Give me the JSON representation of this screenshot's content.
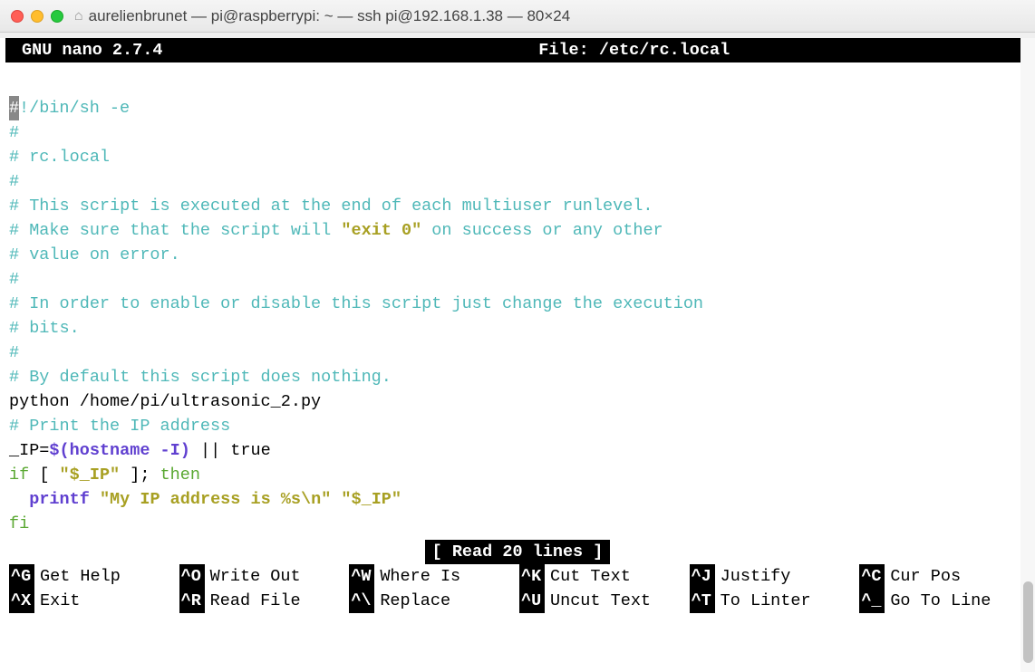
{
  "window": {
    "title": "aurelienbrunet — pi@raspberrypi: ~ — ssh pi@192.168.1.38 — 80×24"
  },
  "nano": {
    "app_name": "GNU nano 2.7.4",
    "file_label": "File: /etc/rc.local",
    "status": "[ Read 20 lines ]"
  },
  "content": {
    "l1_a": "#",
    "l1_b": "!/bin/sh -e",
    "l2": "#",
    "l3": "# rc.local",
    "l4": "#",
    "l5": "# This script is executed at the end of each multiuser runlevel.",
    "l6a": "# Make sure that the script will ",
    "l6b": "\"exit 0\"",
    "l6c": " on success or any other",
    "l7": "# value on error.",
    "l8": "#",
    "l9": "# In order to enable or disable this script just change the execution",
    "l10": "# bits.",
    "l11": "#",
    "l12": "# By default this script does nothing.",
    "l13": "python /home/pi/ultrasonic_2.py",
    "l14": "# Print the IP address",
    "l15a": "_IP=",
    "l15b": "$(hostname -I)",
    "l15c": " || true",
    "l16a": "if",
    "l16b": " [ ",
    "l16c": "\"$_IP\"",
    "l16d": " ]; ",
    "l16e": "then",
    "l17a": "  ",
    "l17b": "printf",
    "l17c": " ",
    "l17d": "\"My IP address is %s\\n\" \"$_IP\"",
    "l18": "fi"
  },
  "shortcuts": [
    {
      "key": "^G",
      "label": "Get Help"
    },
    {
      "key": "^O",
      "label": "Write Out"
    },
    {
      "key": "^W",
      "label": "Where Is"
    },
    {
      "key": "^K",
      "label": "Cut Text"
    },
    {
      "key": "^J",
      "label": "Justify"
    },
    {
      "key": "^C",
      "label": "Cur Pos"
    },
    {
      "key": "^X",
      "label": "Exit"
    },
    {
      "key": "^R",
      "label": "Read File"
    },
    {
      "key": "^\\",
      "label": "Replace"
    },
    {
      "key": "^U",
      "label": "Uncut Text"
    },
    {
      "key": "^T",
      "label": "To Linter"
    },
    {
      "key": "^_",
      "label": "Go To Line"
    }
  ]
}
